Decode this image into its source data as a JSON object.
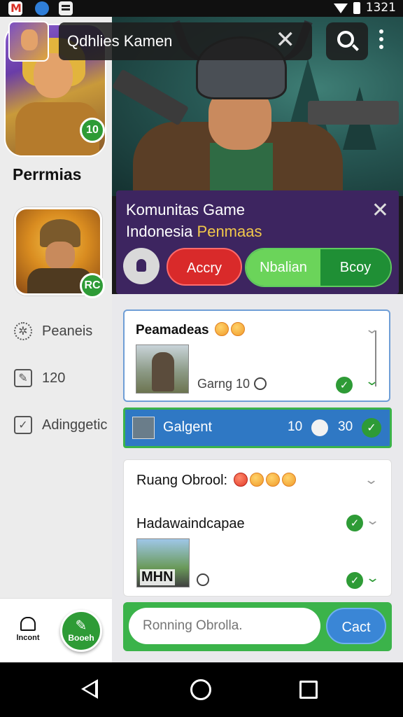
{
  "status_bar": {
    "time": "1321"
  },
  "app_bar": {
    "search_query": "Qdhlies Kamen",
    "close_icon": "close-icon",
    "search_icon": "search-icon",
    "menu_icon": "more-vertical-icon"
  },
  "drawer": {
    "top_avatar_level": "10",
    "title": "Perrmias",
    "mid_avatar_level": "RC",
    "items": [
      {
        "icon": "gear-icon",
        "label": "Peaneis"
      },
      {
        "icon": "edit-icon",
        "label": "120"
      },
      {
        "icon": "checkbox-icon",
        "label": "Adinggetic"
      }
    ],
    "bottom": {
      "home_label": "lncont",
      "fab_label": "Booeh"
    }
  },
  "community": {
    "title_line1": "Komunitas Game",
    "title_line2_plain": "Indonesia ",
    "title_line2_highlight": "Penmaas",
    "buttons": {
      "red": "Accry",
      "segment_left": "Nbalian",
      "segment_right": "Bcoy"
    }
  },
  "feed": {
    "card1": {
      "title": "Peamadeas",
      "meta": "Garng 10"
    },
    "highlight_row": {
      "label": "Galgent",
      "count1": "10",
      "count2": "30"
    },
    "card3": {
      "title": "Ruang Obrool:",
      "subtitle": "Hadawaindcapae",
      "thumb_text": "MHN"
    },
    "composer": {
      "placeholder": "Ronning Obrolla.",
      "send_label": "Cact"
    }
  },
  "colors": {
    "accent_green": "#2e9b36",
    "community_purple": "#3d2560",
    "highlight_yellow": "#f2c84a",
    "danger_red": "#d92a2a",
    "bar_blue": "#2f78c4"
  }
}
